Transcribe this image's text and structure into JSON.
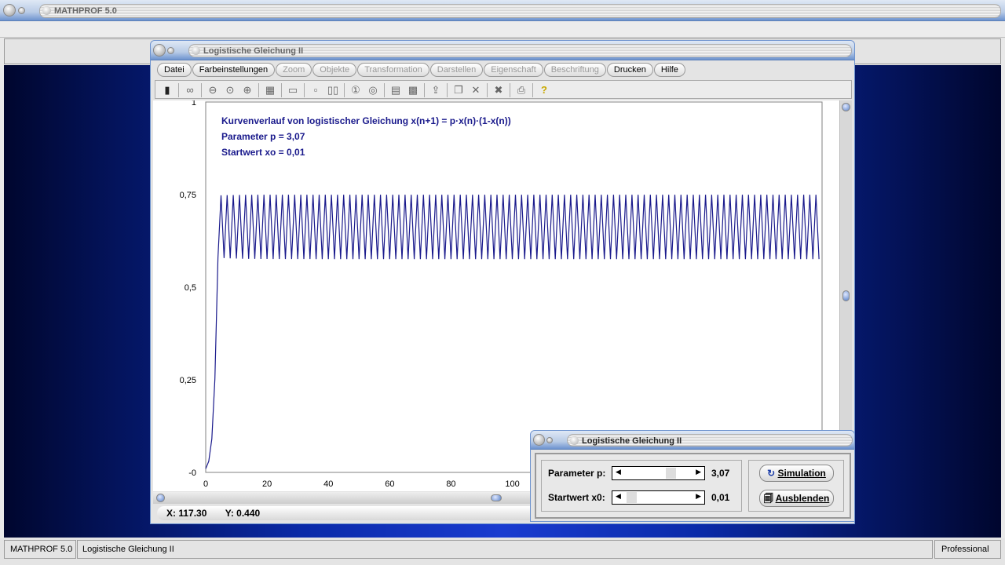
{
  "app": {
    "title": "MATHPROF 5.0"
  },
  "window": {
    "title": "Logistische Gleichung II",
    "menu": [
      {
        "label": "Datei",
        "enabled": true
      },
      {
        "label": "Farbeinstellungen",
        "enabled": true
      },
      {
        "label": "Zoom",
        "enabled": false
      },
      {
        "label": "Objekte",
        "enabled": false
      },
      {
        "label": "Transformation",
        "enabled": false
      },
      {
        "label": "Darstellen",
        "enabled": false
      },
      {
        "label": "Eigenschaft",
        "enabled": false
      },
      {
        "label": "Beschriftung",
        "enabled": false
      },
      {
        "label": "Drucken",
        "enabled": true
      },
      {
        "label": "Hilfe",
        "enabled": true
      }
    ],
    "toolbar": [
      "window-icon",
      "glasses-icon",
      "zoom-out-icon",
      "zoom-reset-icon",
      "zoom-in-icon",
      "properties-icon",
      "layout-icon",
      "point-icon",
      "grid-icon",
      "circle-1-icon",
      "circle-2-icon",
      "table-icon",
      "calculator-icon",
      "export-icon",
      "copy-icon",
      "cross-icon",
      "cross-double-icon",
      "print-icon",
      "help-icon"
    ],
    "coords": {
      "x": "X: 117.30",
      "y": "Y: 0.440"
    }
  },
  "chart_data": {
    "type": "line",
    "annotations": [
      "Kurvenverlauf von logistischer Gleichung x(n+1) = p·x(n)·(1-x(n))",
      "Parameter p = 3,07",
      "Startwert xo = 0,01"
    ],
    "formula": "x(n+1) = p*x(n)*(1-x(n))",
    "p": 3.07,
    "x0": 0.01,
    "n_range": [
      0,
      200
    ],
    "xlim": [
      0,
      201
    ],
    "ylim": [
      0,
      1
    ],
    "xticks": [
      "0",
      "20",
      "40",
      "60",
      "80",
      "100"
    ],
    "xtick_values": [
      0,
      20,
      40,
      60,
      80,
      100
    ],
    "yticks": [
      "1",
      "0,75",
      "0,5",
      "0,25",
      "-0"
    ],
    "ytick_values": [
      1,
      0.75,
      0.5,
      0.25,
      0
    ],
    "color": "#1a1a8c",
    "grid": false
  },
  "dialog": {
    "title": "Logistische Gleichung II",
    "param_label": "Parameter p:",
    "param_value": "3,07",
    "param_position": 0.72,
    "start_label": "Startwert x0:",
    "start_value": "0,01",
    "start_position": 0.05,
    "simulation_label": "Simulation",
    "hide_label": "Ausblenden"
  },
  "statusbar": {
    "app": "MATHPROF 5.0",
    "doc": "Logistische Gleichung II",
    "edition": "Professional"
  }
}
